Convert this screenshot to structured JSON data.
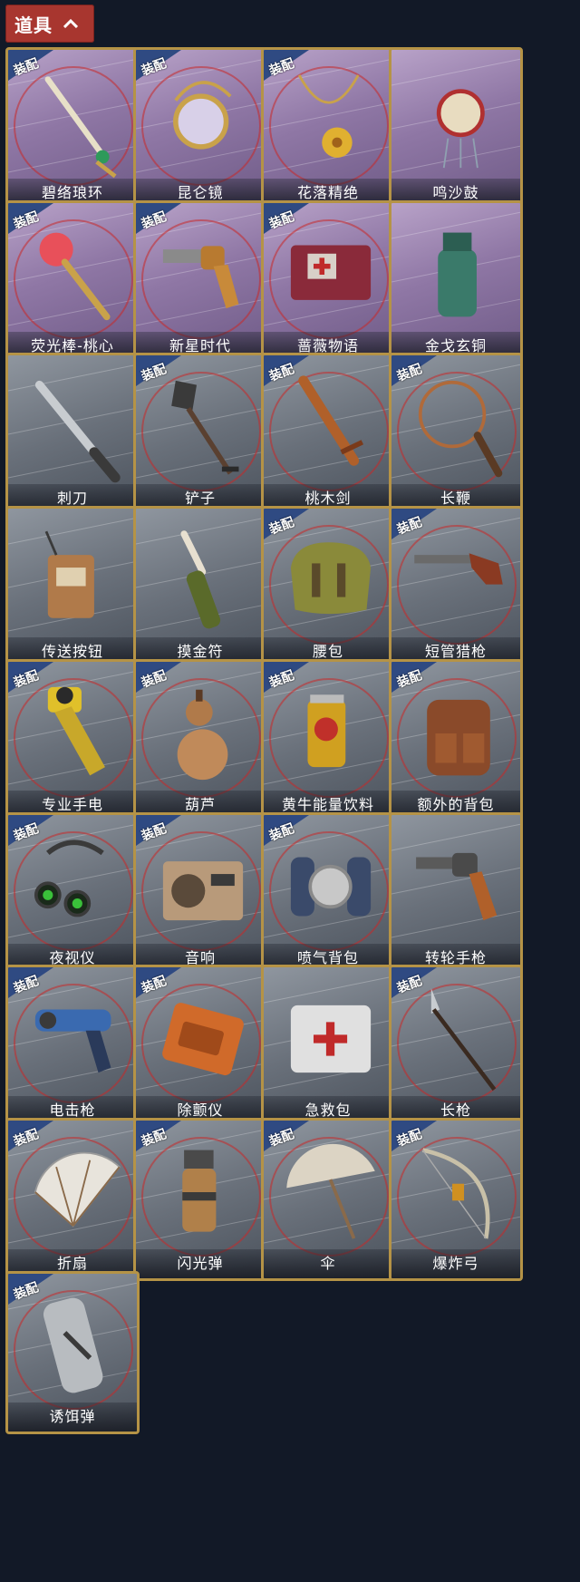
{
  "header": {
    "title": "道具"
  },
  "equipped_label": "装配",
  "colors": {
    "header_bg": "#a8362f",
    "frame_gold": "#b59346",
    "bg": "#121927",
    "badge_blue": "#2f4a82"
  },
  "items": [
    {
      "name": "碧络琅环",
      "equipped": true,
      "style": "purple",
      "icon": "jade-dagger-icon"
    },
    {
      "name": "昆仑镜",
      "equipped": true,
      "style": "purple",
      "icon": "ornate-mirror-icon"
    },
    {
      "name": "花落精绝",
      "equipped": true,
      "style": "purple",
      "icon": "gold-flower-necklace-icon"
    },
    {
      "name": "鸣沙鼓",
      "equipped": false,
      "style": "purple",
      "icon": "hand-drum-icon"
    },
    {
      "name": "荧光棒-桃心",
      "equipped": true,
      "style": "purple",
      "icon": "heart-wand-icon"
    },
    {
      "name": "新星时代",
      "equipped": true,
      "style": "purple",
      "icon": "revolver-gold-icon"
    },
    {
      "name": "蔷薇物语",
      "equipped": true,
      "style": "purple",
      "icon": "medkit-red-icon"
    },
    {
      "name": "金戈玄铜",
      "equipped": false,
      "style": "purple",
      "icon": "bronze-grenade-icon"
    },
    {
      "name": "刺刀",
      "equipped": false,
      "style": "gray",
      "icon": "bayonet-icon"
    },
    {
      "name": "铲子",
      "equipped": true,
      "style": "gray",
      "icon": "shovel-icon"
    },
    {
      "name": "桃木剑",
      "equipped": true,
      "style": "gray",
      "icon": "wooden-sword-icon"
    },
    {
      "name": "长鞭",
      "equipped": true,
      "style": "gray",
      "icon": "whip-icon"
    },
    {
      "name": "传送按钮",
      "equipped": false,
      "style": "gray",
      "icon": "teleport-device-icon"
    },
    {
      "name": "摸金符",
      "equipped": false,
      "style": "gray",
      "icon": "talisman-icon"
    },
    {
      "name": "腰包",
      "equipped": true,
      "style": "gray",
      "icon": "waist-bag-icon"
    },
    {
      "name": "短管猎枪",
      "equipped": true,
      "style": "gray",
      "icon": "shotgun-icon"
    },
    {
      "name": "专业手电",
      "equipped": true,
      "style": "gray",
      "icon": "flashlight-icon"
    },
    {
      "name": "葫芦",
      "equipped": true,
      "style": "gray",
      "icon": "gourd-icon"
    },
    {
      "name": "黄牛能量饮料",
      "equipped": true,
      "style": "gray",
      "icon": "energy-drink-icon"
    },
    {
      "name": "额外的背包",
      "equipped": true,
      "style": "gray",
      "icon": "backpack-icon"
    },
    {
      "name": "夜视仪",
      "equipped": true,
      "style": "gray",
      "icon": "night-vision-icon"
    },
    {
      "name": "音响",
      "equipped": true,
      "style": "gray",
      "icon": "radio-icon"
    },
    {
      "name": "喷气背包",
      "equipped": true,
      "style": "gray",
      "icon": "jetpack-icon"
    },
    {
      "name": "转轮手枪",
      "equipped": false,
      "style": "gray",
      "icon": "revolver-icon"
    },
    {
      "name": "电击枪",
      "equipped": true,
      "style": "gray",
      "icon": "taser-gun-icon"
    },
    {
      "name": "除颤仪",
      "equipped": true,
      "style": "gray",
      "icon": "defibrillator-icon"
    },
    {
      "name": "急救包",
      "equipped": false,
      "style": "gray",
      "icon": "first-aid-kit-icon"
    },
    {
      "name": "长枪",
      "equipped": true,
      "style": "gray",
      "icon": "spear-icon"
    },
    {
      "name": "折扇",
      "equipped": true,
      "style": "gray",
      "icon": "folding-fan-icon"
    },
    {
      "name": "闪光弹",
      "equipped": true,
      "style": "gray",
      "icon": "flashbang-icon"
    },
    {
      "name": "伞",
      "equipped": true,
      "style": "gray",
      "icon": "umbrella-icon"
    },
    {
      "name": "爆炸弓",
      "equipped": true,
      "style": "gray",
      "icon": "bow-icon"
    },
    {
      "name": "诱饵弹",
      "equipped": true,
      "style": "gray",
      "icon": "decoy-grenade-icon"
    }
  ]
}
